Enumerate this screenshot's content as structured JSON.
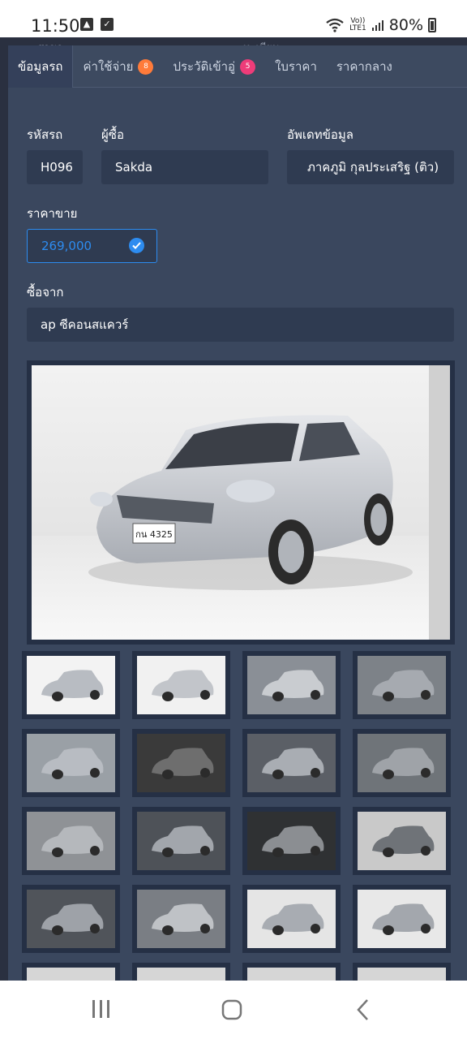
{
  "status_bar": {
    "time": "11:50",
    "network_label_top": "Vo))",
    "network_label_bottom": "LTE1",
    "battery": "80%"
  },
  "backdrop": {
    "ghost_left": "สาขา",
    "ghost_right": "ทะเบียน"
  },
  "tabs": [
    {
      "label": "ข้อมูลรถ",
      "active": true
    },
    {
      "label": "ค่าใช้จ่าย",
      "badge": "8",
      "badge_color": "#ff7b3a"
    },
    {
      "label": "ประวัติเข้าอู่",
      "badge": "5",
      "badge_color": "#ee3c79"
    },
    {
      "label": "ใบราคา"
    },
    {
      "label": "ราคากลาง"
    }
  ],
  "form": {
    "car_code_label": "รหัสรถ",
    "car_code_value": "H096",
    "buyer_label": "ผู้ซื้อ",
    "buyer_value": "Sakda",
    "updated_by_label": "อัพเดทข้อมูล",
    "updated_by_value": "ภาคภูมิ  กุลประเสริฐ (ติว)",
    "price_label": "ราคาขาย",
    "price_value": "269,000",
    "bought_from_label": "ซื้อจาก",
    "bought_from_value": "ap ซีคอนสแควร์"
  },
  "photos": {
    "main_plate": "กน 4325",
    "thumbnail_count": 20
  },
  "colors": {
    "panel": "#3a475e",
    "field": "#2f3b51",
    "accent": "#2d8cf0"
  },
  "nav_bar": {
    "icons": [
      "recent-apps-icon",
      "home-icon",
      "back-icon"
    ]
  }
}
